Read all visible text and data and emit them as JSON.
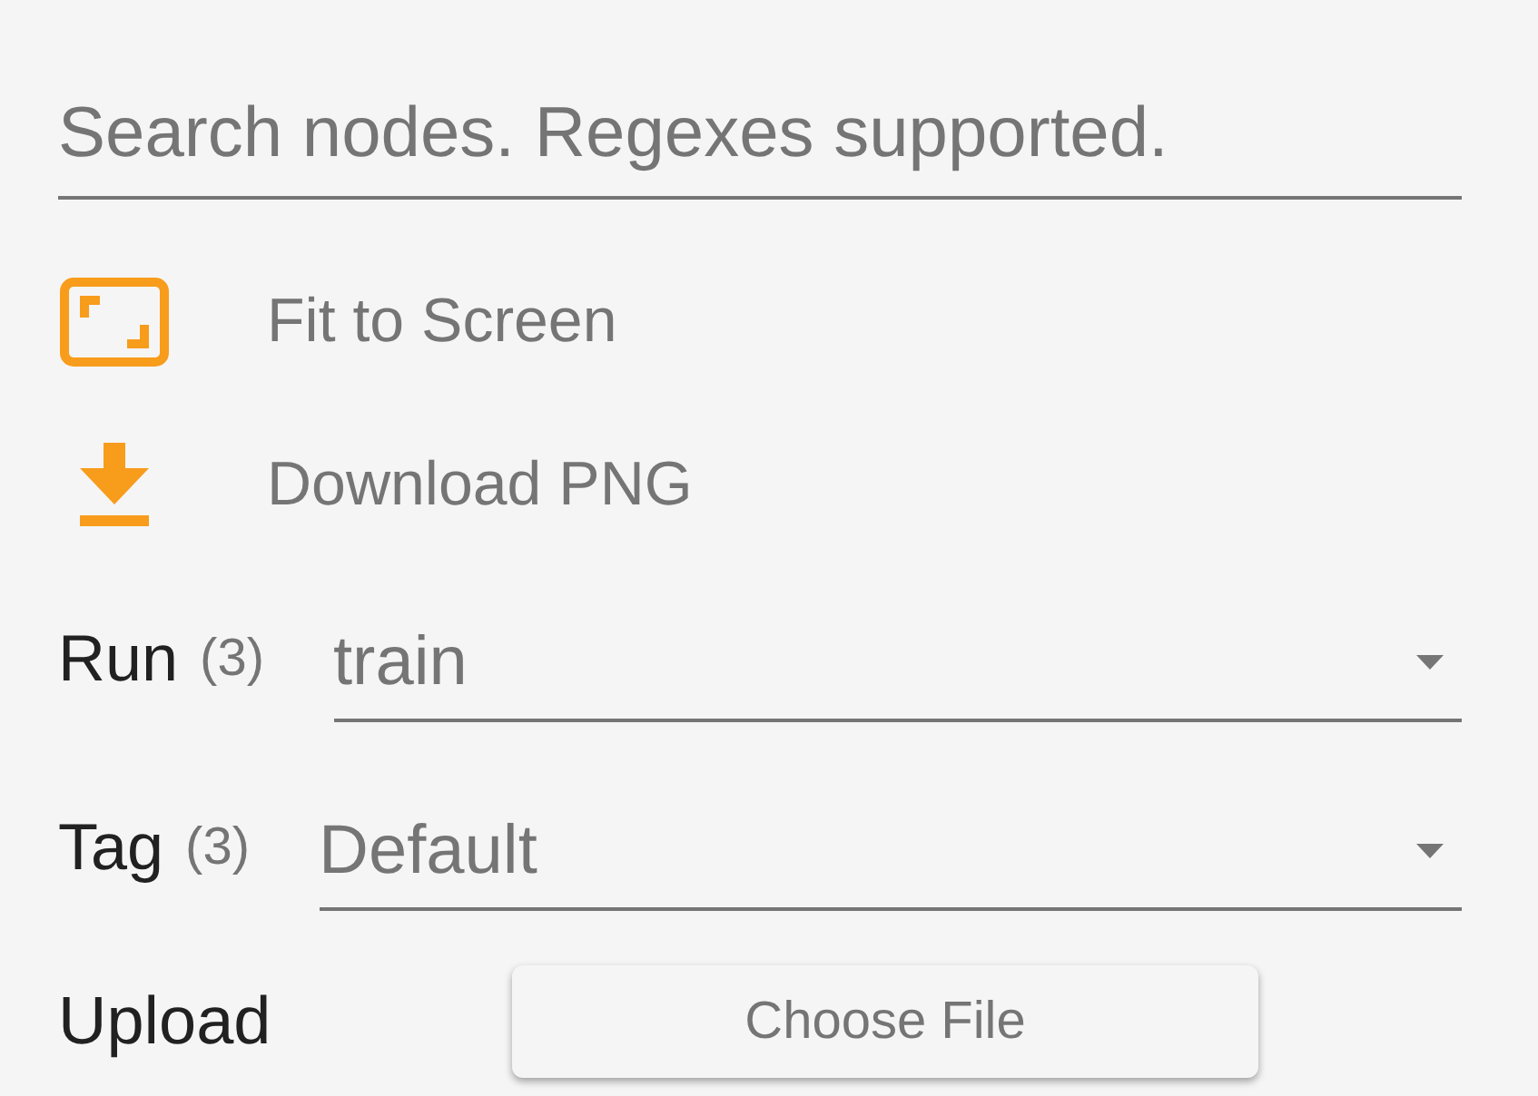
{
  "search": {
    "placeholder": "Search nodes. Regexes supported."
  },
  "actions": [
    {
      "kind": "fit",
      "label": "Fit to Screen"
    },
    {
      "kind": "download",
      "label": "Download PNG"
    }
  ],
  "selectors": [
    {
      "label": "Run",
      "count": "(3)",
      "value": "train"
    },
    {
      "label": "Tag",
      "count": "(3)",
      "value": "Default"
    }
  ],
  "upload": {
    "label": "Upload",
    "button": "Choose File"
  }
}
